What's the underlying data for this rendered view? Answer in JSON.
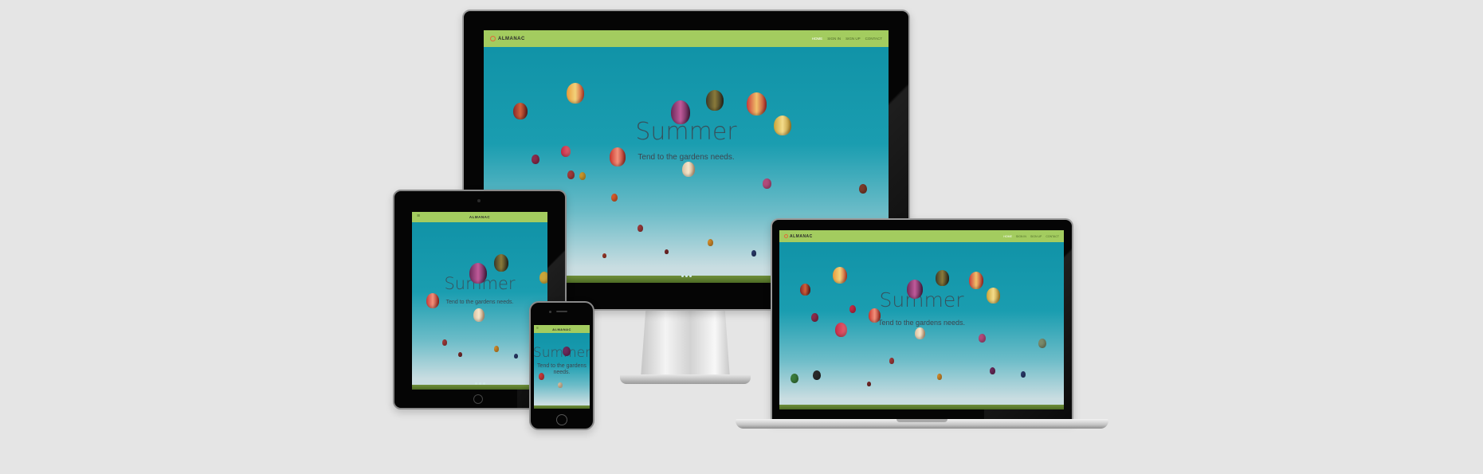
{
  "site": {
    "brand": "ALMANAC",
    "hero_title": "Summer",
    "hero_subtitle": "Tend to the gardens needs.",
    "nav_links": [
      "HOME",
      "SIGN IN",
      "SIGN UP",
      "CONTACT"
    ],
    "active_link": "HOME"
  },
  "icons": {
    "brand": "sun-logo-icon",
    "menu": "hamburger-menu-icon",
    "home_button": "home-button-icon",
    "camera": "camera-icon"
  },
  "colors": {
    "background": "#e5e5e5",
    "navbar": "#a3cc5f",
    "sky": "#1a9db0",
    "hero_text": "#3c4650",
    "brand_icon": "#e06a3a",
    "active_link": "#ffffff"
  },
  "devices": [
    "desktop-monitor",
    "tablet",
    "smartphone",
    "laptop"
  ]
}
